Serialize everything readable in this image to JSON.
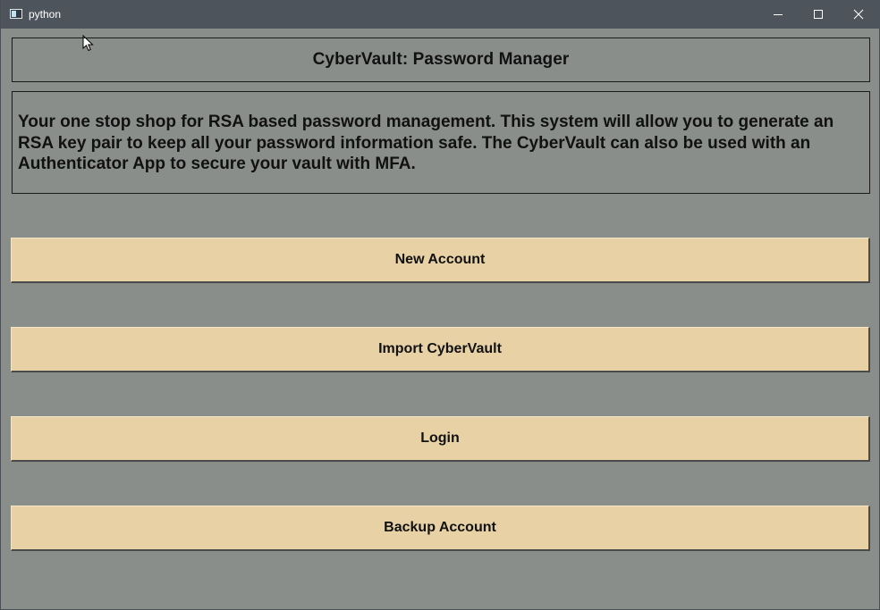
{
  "window": {
    "title": "python",
    "icon": "python-window-icon",
    "controls": {
      "minimize_icon": "minimize-icon",
      "maximize_icon": "maximize-icon",
      "close_icon": "close-icon"
    }
  },
  "header": {
    "title": "CyberVault: Password Manager"
  },
  "description": {
    "text": "Your one stop shop for RSA based password management. This system will allow you to generate an RSA key pair to keep all your password information safe. The CyberVault can also be used with an Authenticator App to secure your vault with MFA."
  },
  "actions": {
    "new_account": "New Account",
    "import_vault": "Import CyberVault",
    "login": "Login",
    "backup_account": "Backup Account"
  },
  "colors": {
    "titlebar": "#4d545c",
    "background": "#8a8e8b",
    "button": "#e8d2a5"
  }
}
